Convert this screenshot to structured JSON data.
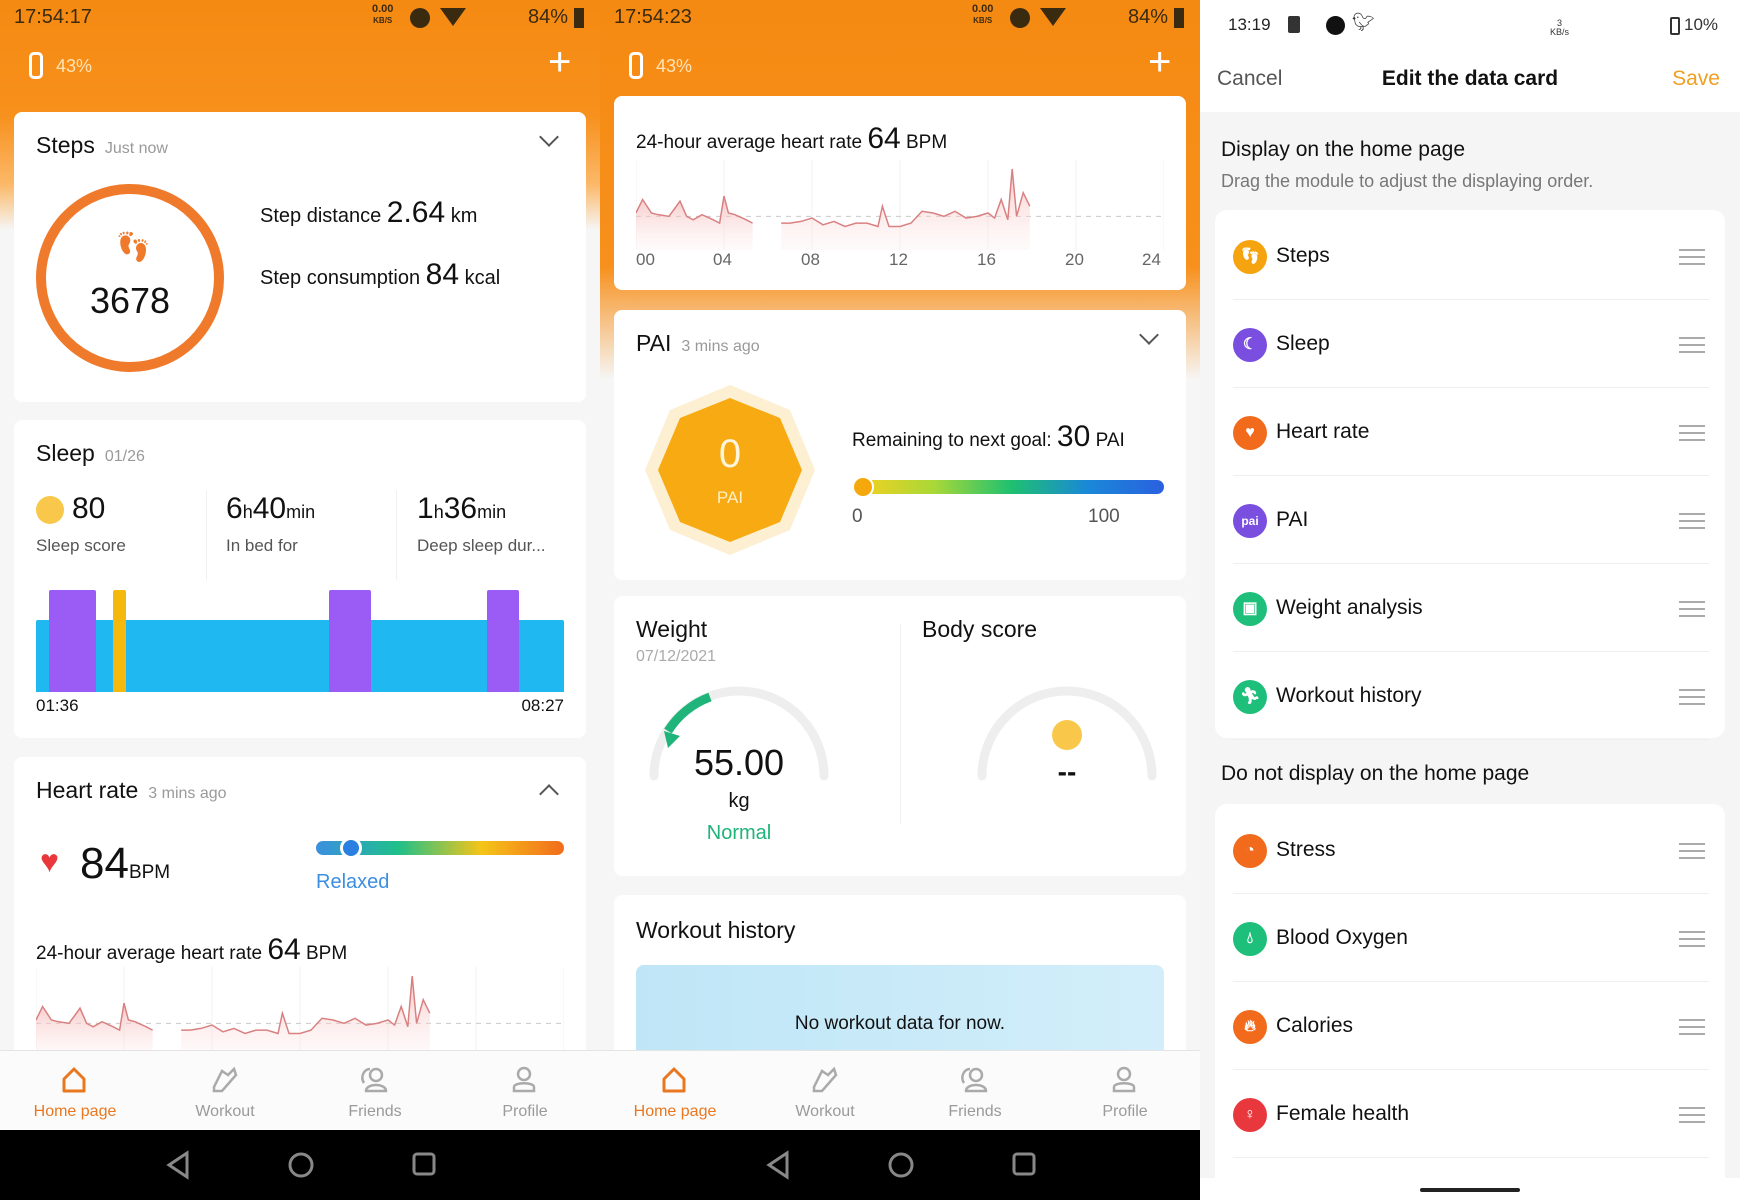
{
  "colors": {
    "accent": "#f58a12",
    "ring": "#f07a2c",
    "light_sleep": "#1fb8f0",
    "deep_sleep": "#9b5cf5",
    "awake": "#f5b80c",
    "save": "#f0a020",
    "normal": "#1fb47a",
    "relaxed": "#3b8fe0"
  },
  "screen1": {
    "status": {
      "time": "17:54:17",
      "speed": "0.00",
      "speed_unit": "KB/S",
      "battery": "84%"
    },
    "device_battery": "43%",
    "steps": {
      "title": "Steps",
      "time": "Just now",
      "count": "3678",
      "distance_label": "Step distance",
      "distance": "2.64",
      "distance_unit": "km",
      "consumption_label": "Step consumption",
      "consumption": "84",
      "consumption_unit": "kcal",
      "goal_progress": 1.0
    },
    "sleep": {
      "title": "Sleep",
      "date": "01/26",
      "score": "80",
      "score_label": "Sleep score",
      "bed_h": "6",
      "bed_m": "40",
      "bed_label": "In bed for",
      "deep_h": "1",
      "deep_m": "36",
      "deep_label": "Deep sleep dur...",
      "h": "h",
      "min": "min",
      "start": "01:36",
      "end": "08:27",
      "stages": [
        {
          "stage": "light",
          "from": "01:36",
          "to": "08:27"
        },
        {
          "stage": "deep",
          "from": "01:46",
          "to": "02:23"
        },
        {
          "stage": "awake",
          "from": "02:36",
          "to": "02:46"
        },
        {
          "stage": "deep",
          "from": "05:24",
          "to": "05:57"
        },
        {
          "stage": "deep",
          "from": "07:27",
          "to": "07:52"
        }
      ]
    },
    "heart": {
      "title": "Heart rate",
      "time": "3 mins ago",
      "bpm": "84",
      "bpm_unit": "BPM",
      "zone": "Relaxed",
      "zone_level": 0.14,
      "avg_label": "24-hour average heart rate",
      "avg": "64",
      "avg_unit": "BPM"
    },
    "nav": [
      {
        "label": "Home page",
        "icon": "home-icon"
      },
      {
        "label": "Workout",
        "icon": "shoe-icon"
      },
      {
        "label": "Friends",
        "icon": "friends-icon"
      },
      {
        "label": "Profile",
        "icon": "profile-icon"
      }
    ]
  },
  "screen2": {
    "status": {
      "time": "17:54:23",
      "speed": "0.00",
      "speed_unit": "KB/S",
      "battery": "84%"
    },
    "device_battery": "43%",
    "hr_chart": {
      "avg_label": "24-hour average heart rate",
      "avg": "64",
      "avg_unit": "BPM",
      "ticks": [
        "00",
        "04",
        "08",
        "12",
        "16",
        "20",
        "24"
      ]
    },
    "pai": {
      "title": "PAI",
      "time": "3 mins ago",
      "value": "0",
      "unit": "PAI",
      "remaining_label": "Remaining to next goal:",
      "remaining": "30",
      "remaining_unit": "PAI",
      "min": "0",
      "max": "100",
      "level": 0
    },
    "weight": {
      "title": "Weight",
      "date": "07/12/2021",
      "value": "55.00",
      "unit": "kg",
      "status": "Normal",
      "body_title": "Body score",
      "body_value": "--"
    },
    "workout": {
      "title": "Workout history",
      "empty": "No workout data for now."
    }
  },
  "chart_data": {
    "type": "line",
    "xlabel": "",
    "ylabel": "",
    "xlim": [
      0,
      24
    ],
    "x_ticks": [
      "00",
      "04",
      "08",
      "12",
      "16",
      "20",
      "24"
    ],
    "reference_line": 64,
    "series": [
      {
        "x": [
          0,
          0.3,
          0.7,
          1,
          1.5,
          2,
          2.3,
          2.6,
          3,
          3.5,
          3.8,
          4,
          4.2,
          4.5,
          5,
          5.3
        ],
        "y": [
          66,
          74,
          66,
          65,
          64,
          73,
          64,
          62,
          65,
          62,
          60,
          76,
          66,
          65,
          62,
          60
        ]
      },
      {
        "x": [
          6.6,
          7,
          7.5,
          8,
          8.5,
          9,
          9.5,
          10,
          10.5,
          11,
          11.2,
          11.5,
          12,
          12.5,
          13,
          13.5,
          14,
          14.5,
          15,
          15.5,
          16,
          16.3,
          16.6,
          16.9,
          17.1,
          17.3,
          17.6,
          17.9
        ],
        "y": [
          60,
          60,
          61,
          63,
          59,
          61,
          58,
          60,
          60,
          58,
          70,
          58,
          58,
          60,
          67,
          66,
          64,
          67,
          63,
          64,
          66,
          63,
          74,
          62,
          92,
          64,
          78,
          70
        ]
      }
    ]
  },
  "screen3": {
    "status": {
      "time": "13:19",
      "speed": "3",
      "speed_unit": "KB/s",
      "battery": "10%"
    },
    "cancel": "Cancel",
    "title": "Edit the data card",
    "save": "Save",
    "shown_title": "Display on the home page",
    "shown_hint": "Drag the module to adjust the displaying order.",
    "shown": [
      {
        "name": "Steps",
        "icon": "steps-icon",
        "color": "#f5a30f"
      },
      {
        "name": "Sleep",
        "icon": "sleep-moon-icon",
        "color": "#7a4fe0"
      },
      {
        "name": "Heart rate",
        "icon": "heart-icon",
        "color": "#f26b1d"
      },
      {
        "name": "PAI",
        "icon": "pai-icon",
        "color": "#7a4fe0"
      },
      {
        "name": "Weight analysis",
        "icon": "weight-icon",
        "color": "#1dbf7a"
      },
      {
        "name": "Workout history",
        "icon": "runner-icon",
        "color": "#1dbf7a"
      }
    ],
    "hidden_title": "Do not display on the home page",
    "hidden": [
      {
        "name": "Stress",
        "icon": "stress-icon",
        "color": "#f26b1d"
      },
      {
        "name": "Blood Oxygen",
        "icon": "blood-oxygen-icon",
        "color": "#1dbf7a"
      },
      {
        "name": "Calories",
        "icon": "flame-icon",
        "color": "#f26b1d"
      },
      {
        "name": "Female health",
        "icon": "female-health-icon",
        "color": "#e8383d"
      }
    ]
  }
}
